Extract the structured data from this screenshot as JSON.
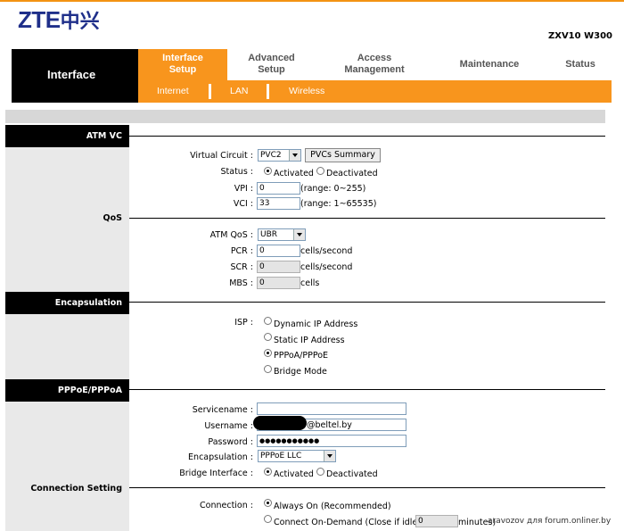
{
  "brand": {
    "logo_latin": "ZTE",
    "logo_cn": "中兴",
    "model": "ZXV10 W300"
  },
  "nav": {
    "section": "Interface",
    "tabs": [
      {
        "line1": "Interface",
        "line2": "Setup"
      },
      {
        "line1": "Advanced",
        "line2": "Setup"
      },
      {
        "line1": "Access",
        "line2": "Management"
      },
      {
        "line1": "Maintenance",
        "line2": ""
      },
      {
        "line1": "Status",
        "line2": ""
      }
    ],
    "subtabs": [
      "Internet",
      "LAN",
      "Wireless"
    ]
  },
  "sections": {
    "atm": "ATM VC",
    "qos": "QoS",
    "encapsulation": "Encapsulation",
    "pppoe": "PPPoE/PPPoA",
    "connection": "Connection Setting"
  },
  "atm": {
    "vc_label": "Virtual Circuit :",
    "vc_value": "PVC2",
    "summary_button": "PVCs Summary",
    "status_label": "Status :",
    "activated": "Activated",
    "deactivated": "Deactivated",
    "vpi_label": "VPI :",
    "vpi_value": "0",
    "vpi_range": "(range: 0~255)",
    "vci_label": "VCI :",
    "vci_value": "33",
    "vci_range": "(range: 1~65535)"
  },
  "qos": {
    "atmqos_label": "ATM QoS :",
    "atmqos_value": "UBR",
    "pcr_label": "PCR :",
    "pcr_value": "0",
    "pcr_unit": "cells/second",
    "scr_label": "SCR :",
    "scr_value": "0",
    "scr_unit": "cells/second",
    "mbs_label": "MBS :",
    "mbs_value": "0",
    "mbs_unit": "cells"
  },
  "isp": {
    "label": "ISP :",
    "options": [
      "Dynamic IP Address",
      "Static IP Address",
      "PPPoA/PPPoE",
      "Bridge Mode"
    ],
    "selected_index": 2
  },
  "pppoe": {
    "servicename_label": "Servicename :",
    "servicename_value": "",
    "username_label": "Username :",
    "username_suffix": "@beltel.by",
    "password_label": "Password :",
    "password_value": "●●●●●●●●●●●",
    "encap_label": "Encapsulation :",
    "encap_value": "PPPoE LLC",
    "bridge_label": "Bridge Interface :",
    "activated": "Activated",
    "deactivated": "Deactivated"
  },
  "connection": {
    "label": "Connection :",
    "always_on": "Always On (Recommended)",
    "on_demand": "Connect On-Demand (Close if idle for",
    "idle_value": "0",
    "idle_unit": "minutes)"
  },
  "watermark": "aravozov для forum.onliner.by",
  "colors": {
    "orange": "#f8951d",
    "logo_blue": "#1f2f8a",
    "black": "#000000",
    "side_grey": "#e9e9e9"
  }
}
